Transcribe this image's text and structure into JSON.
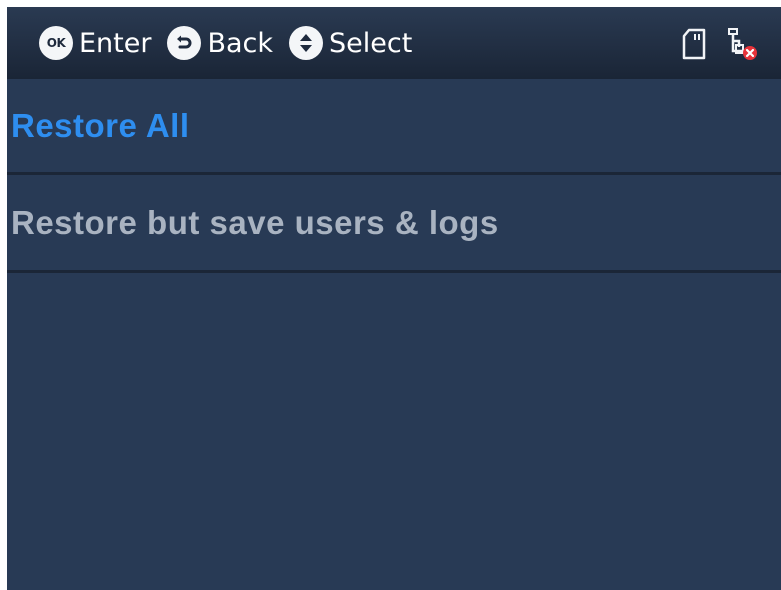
{
  "topbar": {
    "hints": [
      {
        "key": "OK",
        "icon": "ok-button-icon",
        "label": "Enter"
      },
      {
        "key": "",
        "icon": "back-button-icon",
        "label": "Back"
      },
      {
        "key": "",
        "icon": "up-down-button-icon",
        "label": "Select"
      }
    ],
    "status_icons": [
      "sd-card-icon",
      "network-disconnected-icon"
    ]
  },
  "menu": {
    "items": [
      {
        "label": "Restore All",
        "selected": true
      },
      {
        "label": "Restore but save users & logs",
        "selected": false
      }
    ]
  },
  "colors": {
    "background": "#283a55",
    "topbar": "#1f2c40",
    "selected_text": "#2e8ef0",
    "normal_text": "#a9b3c1",
    "divider": "#1b2637",
    "error_badge": "#e8333a"
  }
}
